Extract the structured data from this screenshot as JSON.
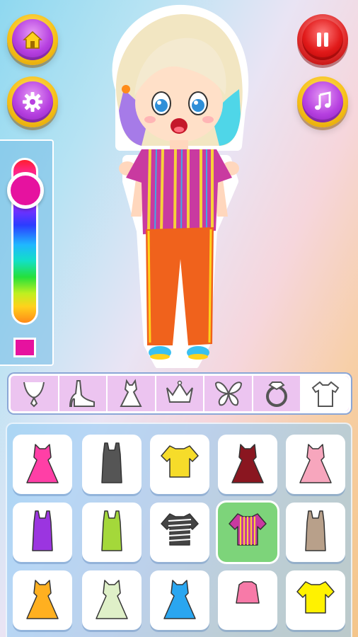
{
  "buttons": {
    "home": {
      "icon": "home-icon"
    },
    "settings": {
      "icon": "gear-icon"
    },
    "pause": {
      "icon": "pause-icon"
    },
    "music": {
      "icon": "music-note-icon"
    }
  },
  "color_picker": {
    "selected_color": "#e6129f",
    "slider_level": 0.1
  },
  "categories": [
    {
      "icon": "necklace-icon",
      "active": false
    },
    {
      "icon": "shoe-icon",
      "active": false
    },
    {
      "icon": "dress-icon",
      "active": false
    },
    {
      "icon": "crown-icon",
      "active": false
    },
    {
      "icon": "wings-icon",
      "active": false
    },
    {
      "icon": "ring-icon",
      "active": false
    },
    {
      "icon": "tshirt-icon",
      "active": true
    }
  ],
  "items": [
    {
      "icon": "pink-ruffle-dress-icon",
      "color": "#ff3fa6",
      "selected": false
    },
    {
      "icon": "gray-tank-top-icon",
      "color": "#555555",
      "selected": false
    },
    {
      "icon": "yellow-knot-top-icon",
      "color": "#f6dc2a",
      "selected": false
    },
    {
      "icon": "maroon-belted-dress-icon",
      "color": "#8a1620",
      "selected": false
    },
    {
      "icon": "pink-tutu-dress-icon",
      "color": "#f7a6bd",
      "selected": false
    },
    {
      "icon": "purple-corset-top-icon",
      "color": "#9b35e0",
      "selected": false
    },
    {
      "icon": "lime-tank-top-icon",
      "color": "#a4d83a",
      "selected": false
    },
    {
      "icon": "striped-top-icon",
      "color": "#444444",
      "selected": false
    },
    {
      "icon": "striped-oversized-top-icon",
      "color": "#c93aa0",
      "selected": true
    },
    {
      "icon": "beige-tank-top-icon",
      "color": "#b8a08a",
      "selected": false
    },
    {
      "icon": "yellow-sundress-icon",
      "color": "#ffb020",
      "selected": false
    },
    {
      "icon": "floral-dress-icon",
      "color": "#dff0c8",
      "selected": false
    },
    {
      "icon": "blue-skater-dress-icon",
      "color": "#2aa6f0",
      "selected": false
    },
    {
      "icon": "pink-crop-top-icon",
      "color": "#f77aa8",
      "selected": false
    },
    {
      "icon": "yellow-ruffle-top-icon",
      "color": "#fff200",
      "selected": false
    }
  ]
}
